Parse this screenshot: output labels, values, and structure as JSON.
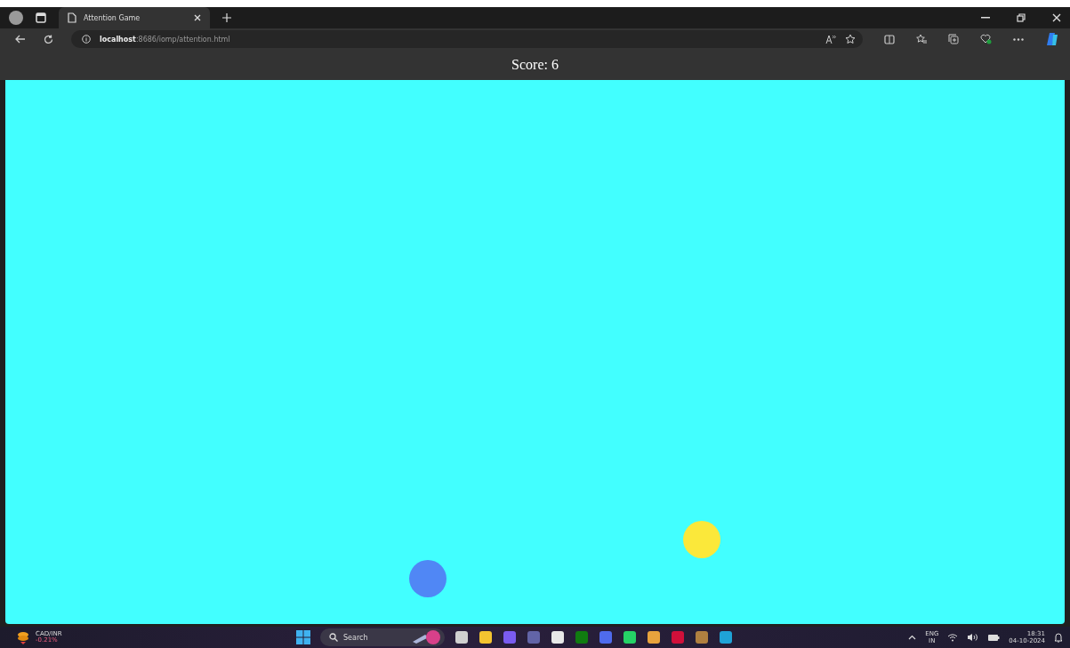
{
  "tab": {
    "title": "Attention Game",
    "selected": true
  },
  "address": {
    "host": "localhost",
    "path": ":8686/iomp/attention.html"
  },
  "game": {
    "score": "Score: 6",
    "balls": [
      {
        "color": "#fbe83a"
      },
      {
        "color": "#5087f5"
      }
    ]
  },
  "taskbar": {
    "widget": {
      "label": "CAD/INR",
      "change": "-0.21%"
    },
    "search": {
      "placeholder": "Search"
    },
    "language": {
      "code": "ENG",
      "region": "IN"
    },
    "time": "18:31",
    "date": "04-10-2024"
  }
}
